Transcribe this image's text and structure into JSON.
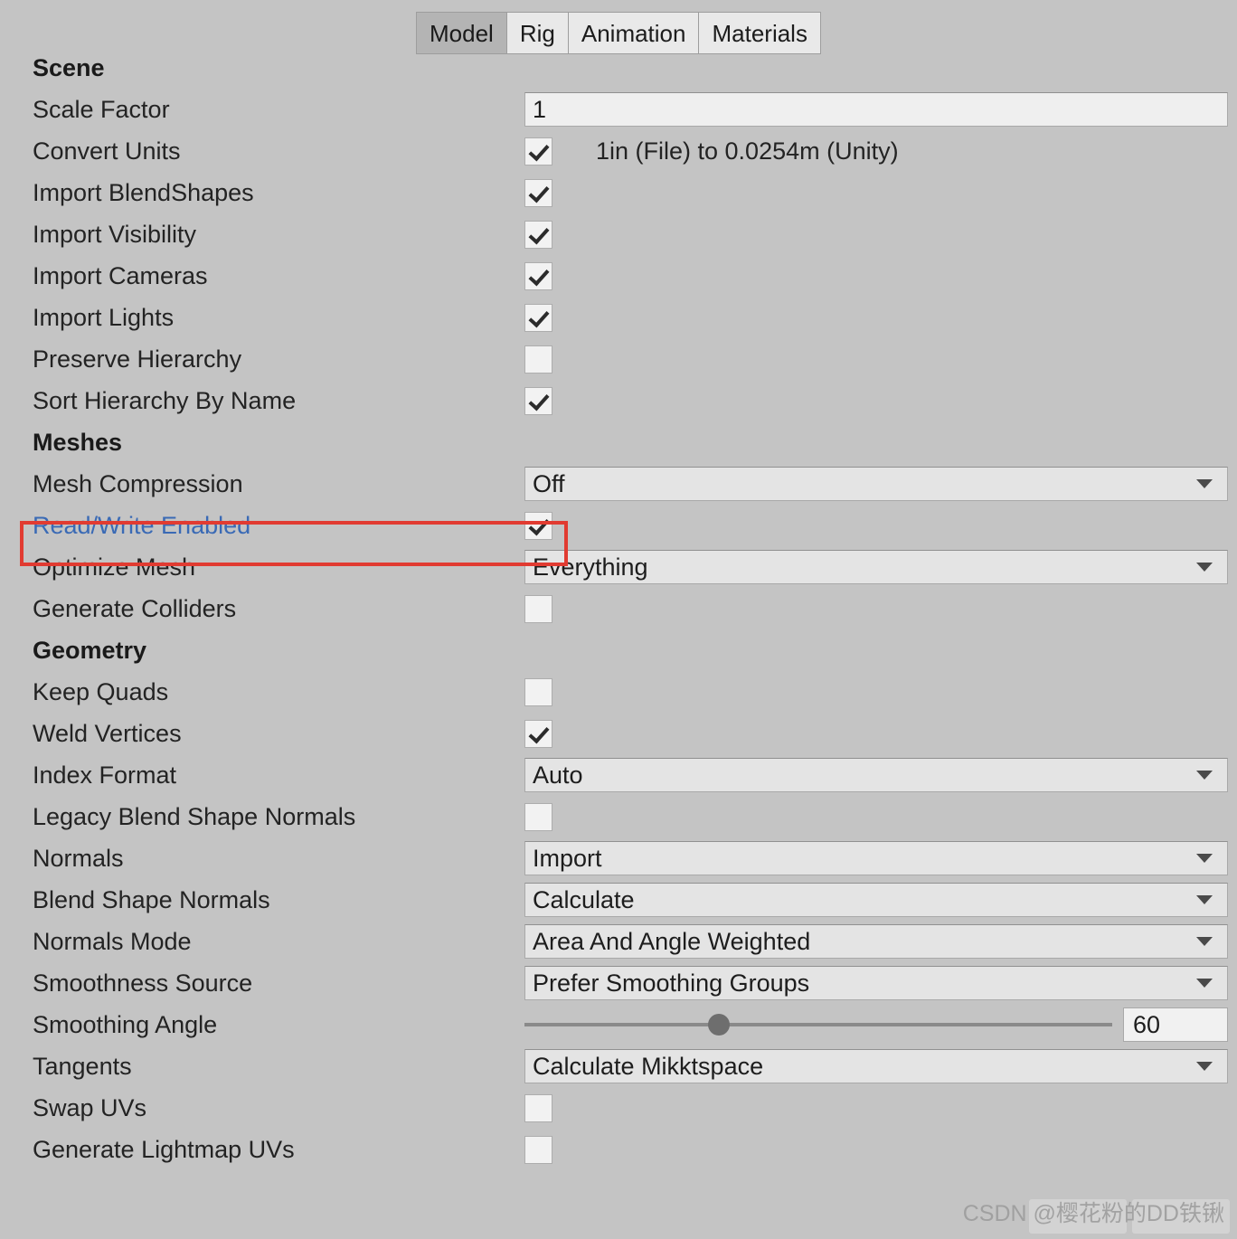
{
  "tabs": [
    {
      "label": "Model",
      "selected": true
    },
    {
      "label": "Rig",
      "selected": false
    },
    {
      "label": "Animation",
      "selected": false
    },
    {
      "label": "Materials",
      "selected": false
    }
  ],
  "sections": {
    "scene": {
      "title": "Scene",
      "scale_factor": {
        "label": "Scale Factor",
        "value": "1"
      },
      "convert_units": {
        "label": "Convert Units",
        "checked": true,
        "note": "1in (File) to 0.0254m (Unity)"
      },
      "import_blendshapes": {
        "label": "Import BlendShapes",
        "checked": true
      },
      "import_visibility": {
        "label": "Import Visibility",
        "checked": true
      },
      "import_cameras": {
        "label": "Import Cameras",
        "checked": true
      },
      "import_lights": {
        "label": "Import Lights",
        "checked": true
      },
      "preserve_hierarchy": {
        "label": "Preserve Hierarchy",
        "checked": false
      },
      "sort_hierarchy": {
        "label": "Sort Hierarchy By Name",
        "checked": true
      }
    },
    "meshes": {
      "title": "Meshes",
      "mesh_compression": {
        "label": "Mesh Compression",
        "value": "Off"
      },
      "read_write_enabled": {
        "label": "Read/Write Enabled",
        "checked": true,
        "highlighted": true
      },
      "optimize_mesh": {
        "label": "Optimize Mesh",
        "value": "Everything"
      },
      "generate_colliders": {
        "label": "Generate Colliders",
        "checked": false
      }
    },
    "geometry": {
      "title": "Geometry",
      "keep_quads": {
        "label": "Keep Quads",
        "checked": false
      },
      "weld_vertices": {
        "label": "Weld Vertices",
        "checked": true
      },
      "index_format": {
        "label": "Index Format",
        "value": "Auto"
      },
      "legacy_blend_shape_normals": {
        "label": "Legacy Blend Shape Normals",
        "checked": false
      },
      "normals": {
        "label": "Normals",
        "value": "Import"
      },
      "blend_shape_normals": {
        "label": "Blend Shape Normals",
        "value": "Calculate"
      },
      "normals_mode": {
        "label": "Normals Mode",
        "value": "Area And Angle Weighted"
      },
      "smoothness_source": {
        "label": "Smoothness Source",
        "value": "Prefer Smoothing Groups"
      },
      "smoothing_angle": {
        "label": "Smoothing Angle",
        "value": "60",
        "percent": 33
      },
      "tangents": {
        "label": "Tangents",
        "value": "Calculate Mikktspace"
      },
      "swap_uvs": {
        "label": "Swap UVs",
        "checked": false
      },
      "generate_lightmap_uvs": {
        "label": "Generate Lightmap UVs",
        "checked": false
      }
    }
  },
  "watermark": {
    "text": "CSDN @樱花粉的DD铁锹"
  },
  "colors": {
    "highlight": "#e13b31",
    "link": "#3a6ab5",
    "background": "#c4c4c4"
  }
}
